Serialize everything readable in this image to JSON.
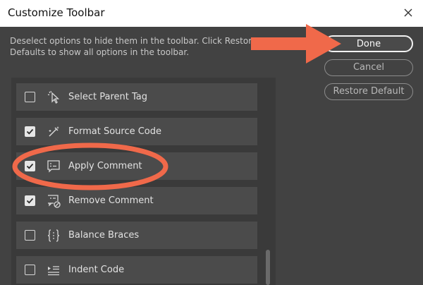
{
  "window": {
    "title": "Customize Toolbar"
  },
  "description": {
    "line1": "Deselect options to hide them in the toolbar. Click Restore",
    "line2": "Defaults to show all options in the toolbar."
  },
  "buttons": {
    "done": "Done",
    "cancel": "Cancel",
    "restore": "Restore Default"
  },
  "items": [
    {
      "label": "Select Parent Tag",
      "checked": false,
      "icon": "select-parent-tag-icon"
    },
    {
      "label": "Format Source Code",
      "checked": true,
      "icon": "format-source-code-icon"
    },
    {
      "label": "Apply Comment",
      "checked": true,
      "icon": "apply-comment-icon"
    },
    {
      "label": "Remove Comment",
      "checked": true,
      "icon": "remove-comment-icon"
    },
    {
      "label": "Balance Braces",
      "checked": false,
      "icon": "balance-braces-icon"
    },
    {
      "label": "Indent Code",
      "checked": false,
      "icon": "indent-code-icon"
    }
  ],
  "colors": {
    "annotation": "#f0694a",
    "panel": "#424242",
    "row": "#4b4b4b"
  }
}
